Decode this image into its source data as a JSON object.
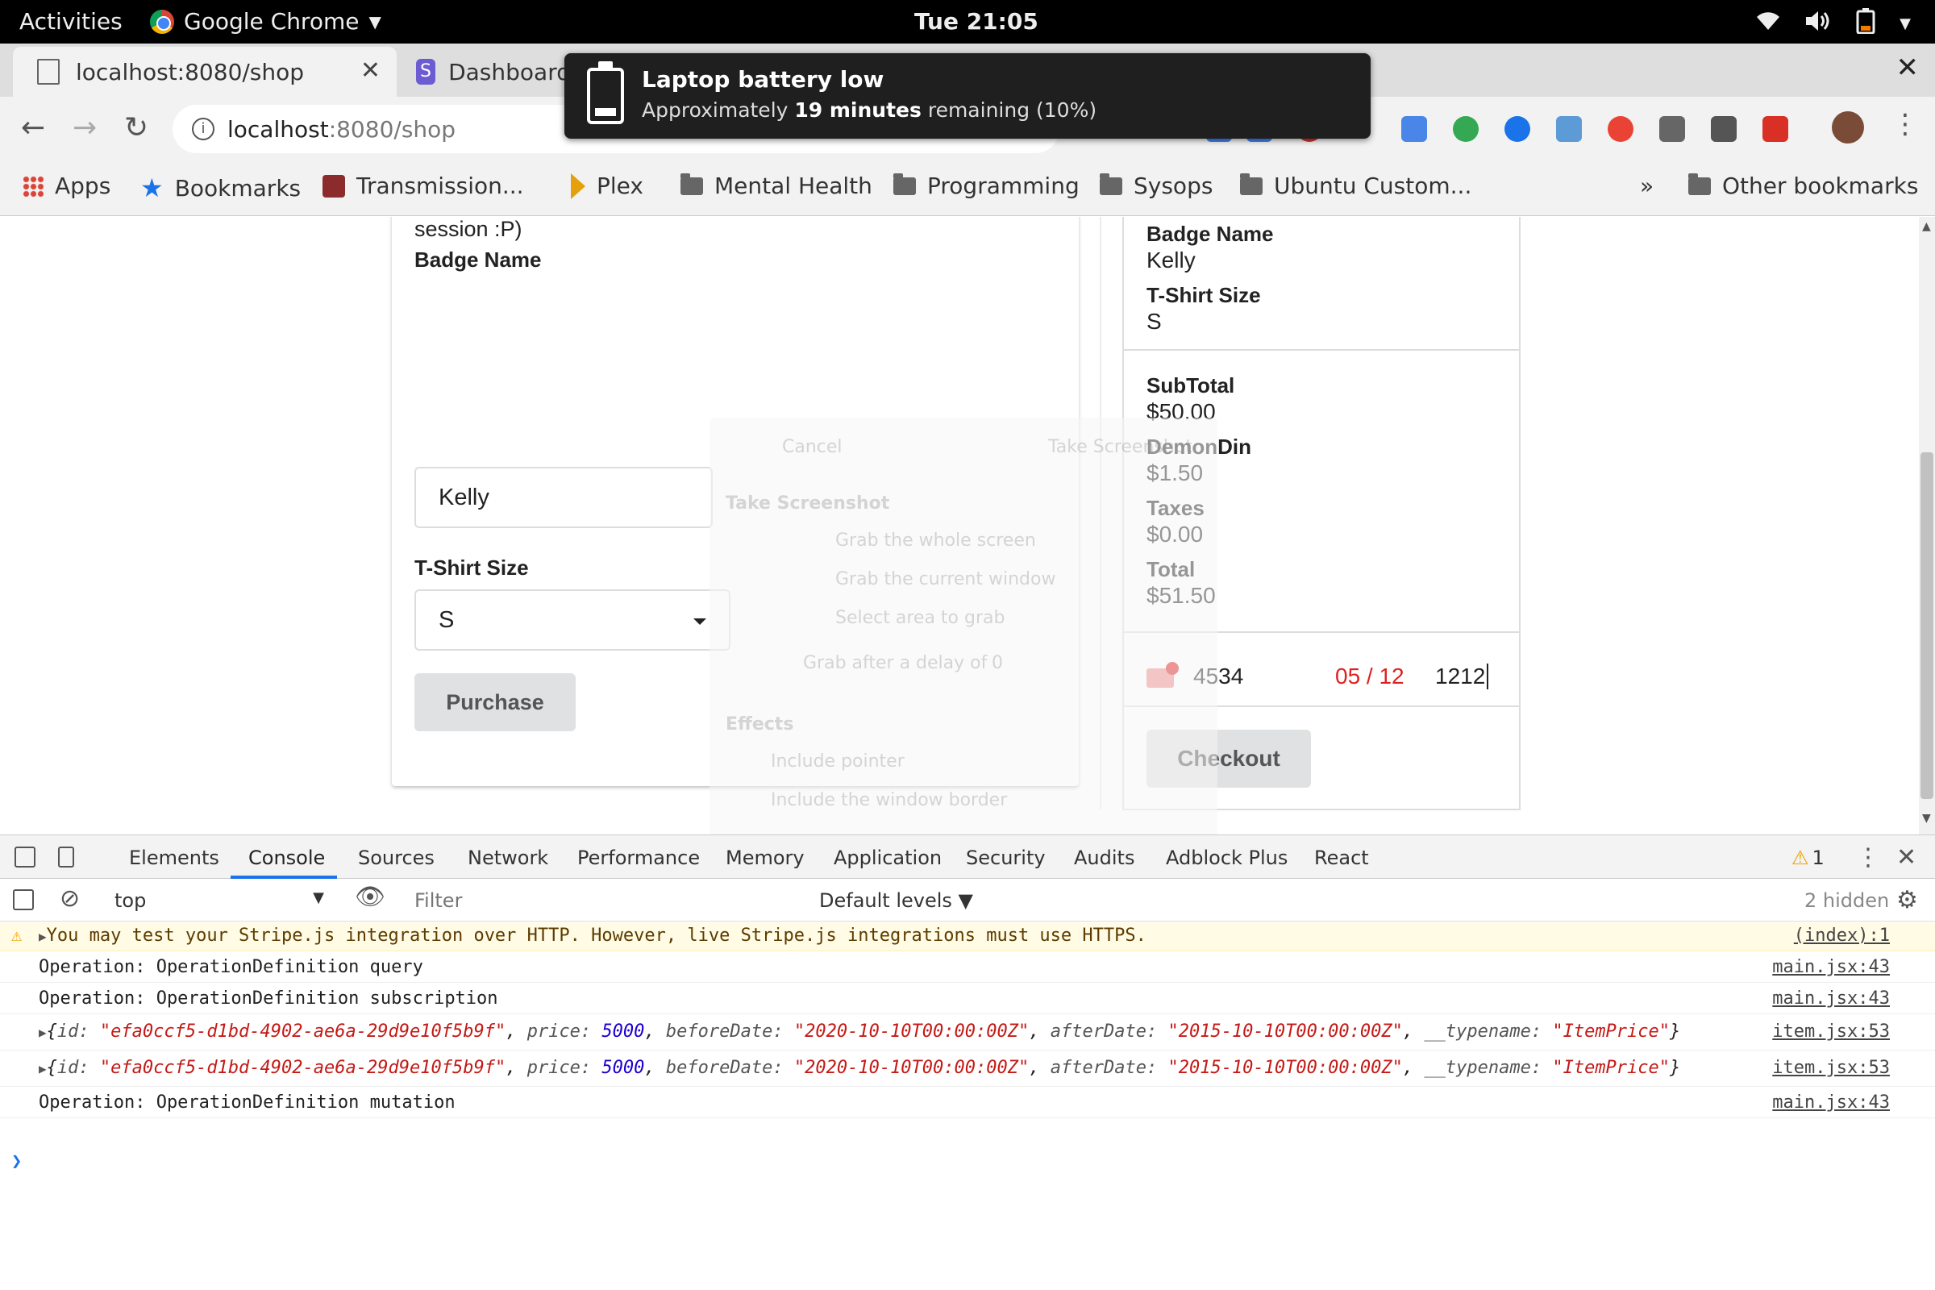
{
  "gnome_bar": {
    "activities": "Activities",
    "app_name": "Google Chrome",
    "clock": "Tue 21:05"
  },
  "tabs": [
    {
      "title": "localhost:8080/shop",
      "active": true
    },
    {
      "title": "Dashboard",
      "active": false
    }
  ],
  "omnibox": {
    "host": "localhost",
    "path": ":8080/shop"
  },
  "bookmarks": {
    "apps": "Apps",
    "items": [
      "Bookmarks",
      "Transmission...",
      "Plex",
      "Mental Health",
      "Programming",
      "Sysops",
      "Ubuntu Custom..."
    ],
    "overflow": "»",
    "other": "Other bookmarks"
  },
  "notification": {
    "title": "Laptop battery low",
    "body_prefix": "Approximately",
    "body_bold": "19 minutes",
    "body_suffix": "remaining (10%)"
  },
  "form": {
    "partial_text": "session :P)",
    "badge_label": "Badge Name",
    "badge_value": "Kelly",
    "size_label": "T-Shirt Size",
    "size_value": "S",
    "purchase_button": "Purchase"
  },
  "summary": {
    "badge_label": "Badge Name",
    "badge_value": "Kelly",
    "size_label": "T-Shirt Size",
    "size_value": "S",
    "subtotal_label": "SubTotal",
    "subtotal_value": "$50.00",
    "fee_label": "DemonDin",
    "fee_value": "$1.50",
    "taxes_label": "Taxes",
    "taxes_value": "$0.00",
    "total_label": "Total",
    "total_value": "$51.50",
    "card_number": "4534",
    "card_expiry": "05 / 12",
    "card_cvc": "1212",
    "checkout_button": "Checkout"
  },
  "screenshot_dialog_ghost": {
    "cancel": "Cancel",
    "take": "Take Screenshot",
    "title": "Take Screenshot",
    "opt1": "Grab the whole screen",
    "opt2": "Grab the current window",
    "opt3": "Select area to grab",
    "delay": "Grab after a delay of",
    "delay_value": "0",
    "effects": "Effects",
    "pointer": "Include pointer",
    "border": "Include the window border"
  },
  "devtools": {
    "tabs": [
      "Elements",
      "Console",
      "Sources",
      "Network",
      "Performance",
      "Memory",
      "Application",
      "Security",
      "Audits",
      "Adblock Plus",
      "React"
    ],
    "active_tab": "Console",
    "warning_count": "1",
    "context": "top",
    "filter_placeholder": "Filter",
    "levels": "Default levels",
    "hidden": "2 hidden",
    "colors": {
      "accent": "#1a73e8",
      "warning": "#f0a000"
    }
  },
  "console": {
    "warning": {
      "text": "You may test your Stripe.js integration over HTTP. However, live Stripe.js integrations must use HTTPS.",
      "source": "(index):1"
    },
    "line1": {
      "text": "Operation: OperationDefinition query",
      "source": "main.jsx:43"
    },
    "line2": {
      "text": "Operation: OperationDefinition subscription",
      "source": "main.jsx:43"
    },
    "obj1": {
      "id": "\"efa0ccf5-d1bd-4902-ae6a-29d9e10f5b9f\"",
      "price": "5000",
      "beforeDate": "\"2020-10-10T00:00:00Z\"",
      "afterDate": "\"2015-10-10T00:00:00Z\"",
      "typename": "\"ItemPrice\"",
      "source": "item.jsx:53"
    },
    "obj2": {
      "id": "\"efa0ccf5-d1bd-4902-ae6a-29d9e10f5b9f\"",
      "price": "5000",
      "beforeDate": "\"2020-10-10T00:00:00Z\"",
      "afterDate": "\"2015-10-10T00:00:00Z\"",
      "typename": "\"ItemPrice\"",
      "source": "item.jsx:53"
    },
    "line3": {
      "text": "Operation: OperationDefinition mutation",
      "source": "main.jsx:43"
    }
  }
}
